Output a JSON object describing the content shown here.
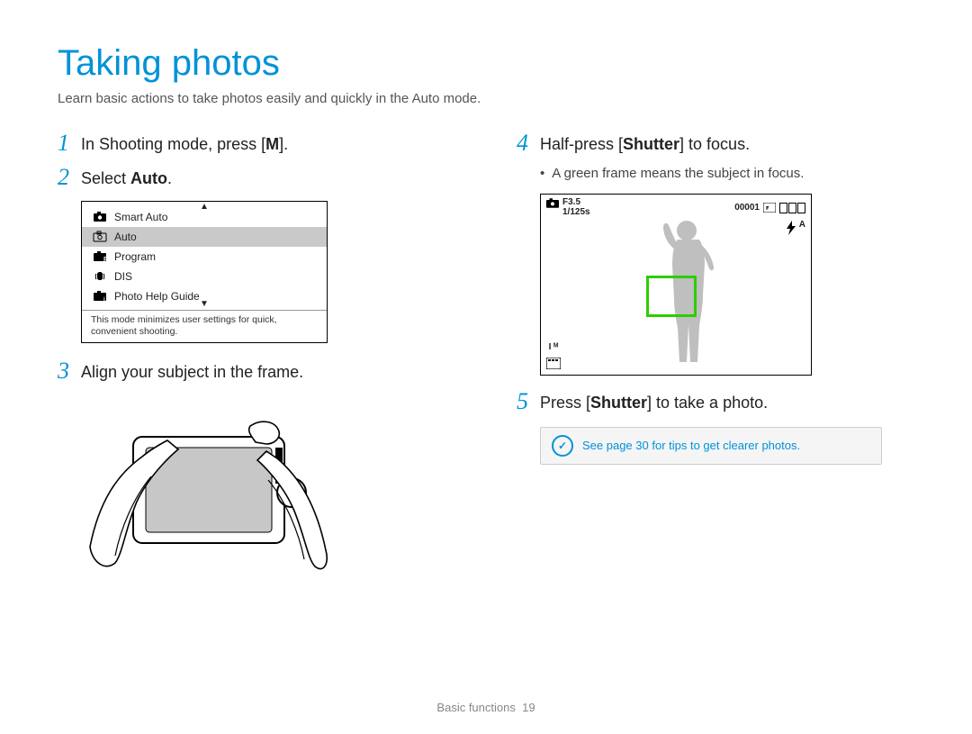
{
  "title": "Taking photos",
  "intro": "Learn basic actions to take photos easily and quickly in the Auto mode.",
  "steps": {
    "s1": {
      "num": "1",
      "pre": "In Shooting mode, press [",
      "key": "M",
      "post": "]."
    },
    "s2": {
      "num": "2",
      "pre": "Select ",
      "bold": "Auto",
      "post": "."
    },
    "s3": {
      "num": "3",
      "text": "Align your subject in the frame."
    },
    "s4": {
      "num": "4",
      "pre": "Half-press [",
      "bold": "Shutter",
      "post": "] to focus."
    },
    "s4b": "A green frame means the subject in focus.",
    "s5": {
      "num": "5",
      "pre": "Press [",
      "bold": "Shutter",
      "post": "] to take a photo."
    }
  },
  "menu": {
    "items": [
      "Smart Auto",
      "Auto",
      "Program",
      "DIS",
      "Photo Help Guide"
    ],
    "selected": 1,
    "help": "This mode minimizes user settings for quick, convenient shooting."
  },
  "screen": {
    "f": "F3.5",
    "s": "1/125s",
    "count": "00001",
    "flash": "ꜰᴬ",
    "mode": "I ᴹ"
  },
  "note": "See page 30 for tips to get clearer photos.",
  "footer": {
    "section": "Basic functions",
    "page": "19"
  }
}
